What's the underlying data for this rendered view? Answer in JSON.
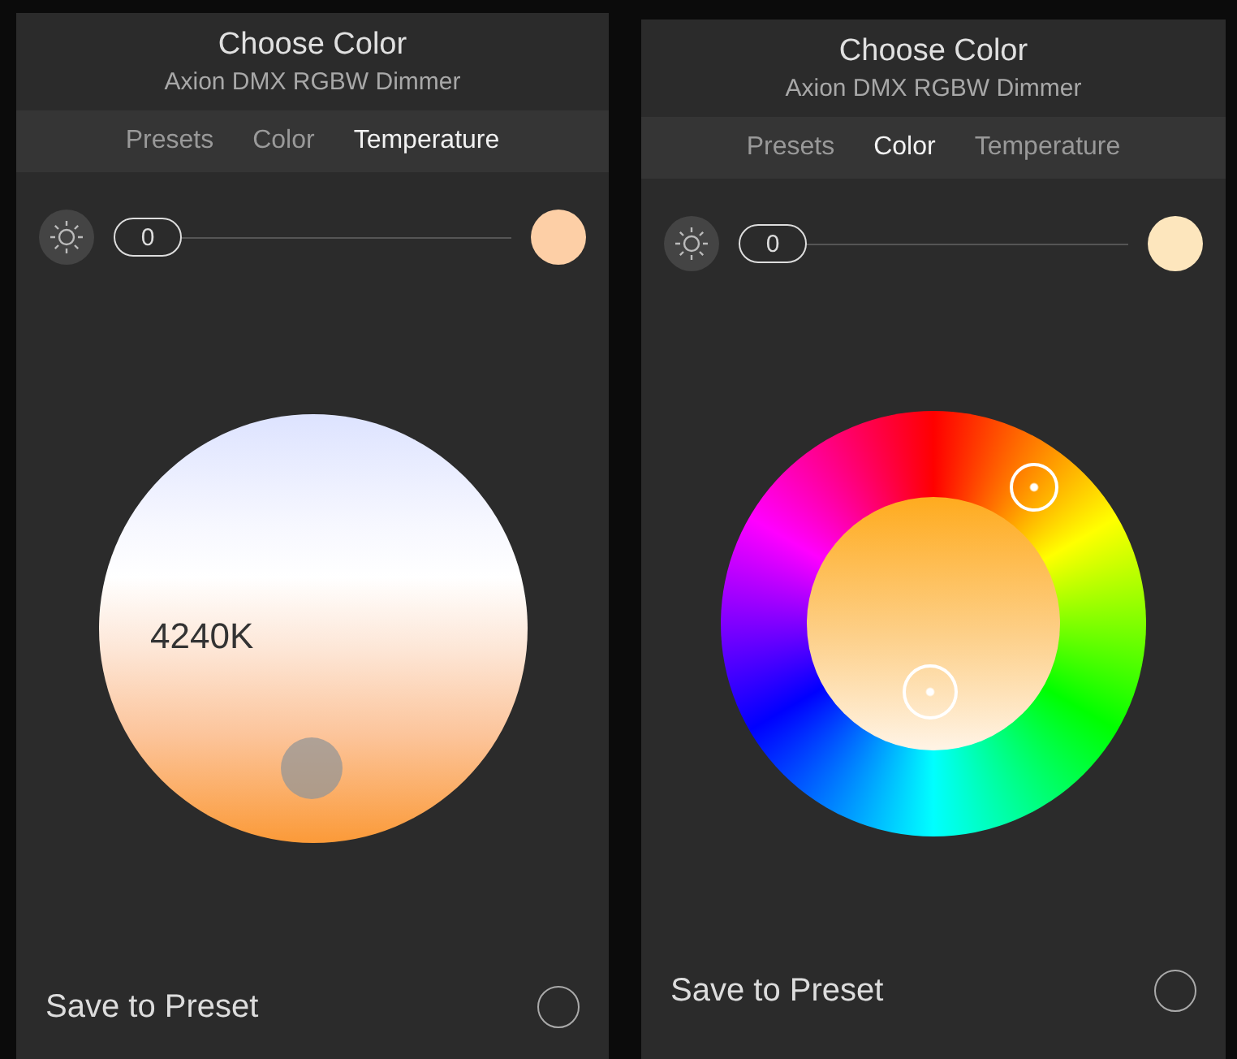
{
  "panels": [
    {
      "kind": "temperature",
      "title": "Choose Color",
      "subtitle": "Axion DMX RGBW Dimmer",
      "tabs": [
        {
          "label": "Presets",
          "selected": false
        },
        {
          "label": "Color",
          "selected": false
        },
        {
          "label": "Temperature",
          "selected": true
        }
      ],
      "brightness": {
        "reading": "0",
        "level": 0
      },
      "color": "#fdcfa6",
      "temperature": "4240K",
      "save": {
        "label": "Save to Preset",
        "checked": false
      }
    },
    {
      "kind": "color",
      "title": "Choose Color",
      "subtitle": "Axion DMX RGBW Dimmer",
      "tabs": [
        {
          "label": "Presets",
          "selected": false
        },
        {
          "label": "Color",
          "selected": true
        },
        {
          "label": "Temperature",
          "selected": false
        }
      ],
      "brightness": {
        "reading": "0",
        "level": 0
      },
      "color": "#fde6bd",
      "save": {
        "label": "Save to Preset",
        "checked": false
      }
    }
  ]
}
